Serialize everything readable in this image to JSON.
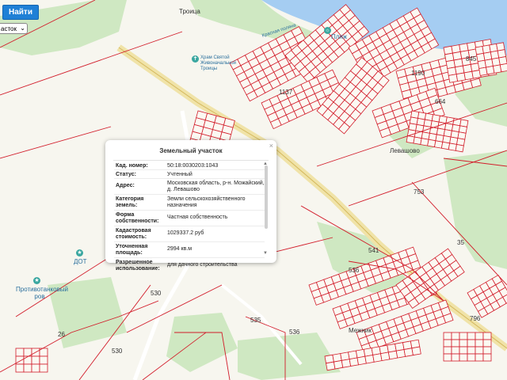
{
  "toolbar": {
    "find_label": "Найти",
    "select_value": "асток"
  },
  "map": {
    "place_labels": [
      {
        "text": "Троица",
        "cls": "dark"
      },
      {
        "text": "Пляж",
        "cls": ""
      },
      {
        "text": "Храм Святой Живоначальной Троицы",
        "cls": ""
      },
      {
        "text": "Левашово",
        "cls": "dark"
      },
      {
        "text": "ДОТ",
        "cls": ""
      },
      {
        "text": "Противотанковый ров",
        "cls": ""
      },
      {
        "text": "Межник",
        "cls": "dark"
      },
      {
        "text": "Красная поляна",
        "cls": ""
      }
    ],
    "parcel_numbers": [
      "753",
      "35",
      "541",
      "536",
      "530",
      "535",
      "536",
      "530",
      "26",
      "1137",
      "664",
      "1190",
      "845",
      "796"
    ]
  },
  "popup": {
    "title": "Земельный участок",
    "close": "×",
    "rows": [
      {
        "key": "Кад. номер:",
        "value": "50:18:0030203:1043"
      },
      {
        "key": "Статус:",
        "value": "Учтенный"
      },
      {
        "key": "Адрес:",
        "value": "Московская область, р-н. Можайский, д. Левашово"
      },
      {
        "key": "Категория земель:",
        "value": "Земли сельскохозяйственного назначения"
      },
      {
        "key": "Форма собственности:",
        "value": "Частная собственность"
      },
      {
        "key": "Кадастровая стоимость:",
        "value": "1029337.2 руб"
      },
      {
        "key": "Уточненная площадь:",
        "value": "2994 кв.м"
      },
      {
        "key": "Разрешенное использование:",
        "value": "для дачного строительства"
      }
    ]
  }
}
